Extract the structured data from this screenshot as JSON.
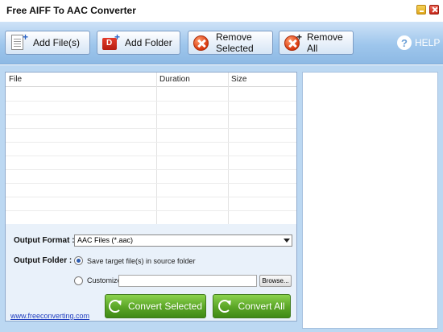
{
  "window": {
    "title": "Free AIFF To AAC Converter"
  },
  "toolbar": {
    "add_files": "Add File(s)",
    "add_folder": "Add Folder",
    "remove_selected": "Remove Selected",
    "remove_all": "Remove All",
    "help": "HELP"
  },
  "file_list": {
    "columns": [
      "File",
      "Duration",
      "Size"
    ],
    "rows": []
  },
  "settings": {
    "output_format_label": "Output Format :",
    "output_format_value": "AAC Files (*.aac)",
    "output_folder_label": "Output Folder :",
    "save_in_source_label": "Save target file(s) in source folder",
    "save_in_source_selected": true,
    "customize_label": "Customize :",
    "customize_path": "",
    "browse_label": "Browse...",
    "website_link": "www.freeconverting.com",
    "convert_selected": "Convert Selected",
    "convert_all": "Convert All"
  },
  "colors": {
    "toolbar_bg": "#9ec6ec",
    "panel_bg": "#bcd8f2",
    "convert_green": "#5aa526",
    "remove_red": "#d9380e"
  }
}
